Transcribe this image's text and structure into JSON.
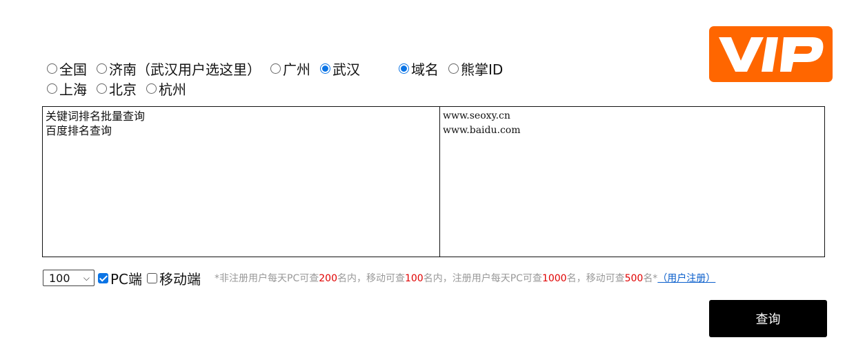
{
  "region_options": {
    "row1": [
      {
        "label": "全国",
        "checked": false
      },
      {
        "label": "济南（武汉用户选这里）",
        "checked": false
      },
      {
        "label": "广州",
        "checked": false
      },
      {
        "label": "武汉",
        "checked": true
      }
    ],
    "row2": [
      {
        "label": "上海",
        "checked": false
      },
      {
        "label": "北京",
        "checked": false
      },
      {
        "label": "杭州",
        "checked": false
      }
    ]
  },
  "mode_options": [
    {
      "label": "域名",
      "checked": true
    },
    {
      "label": "熊掌ID",
      "checked": false
    }
  ],
  "logo": {
    "text": "VIP",
    "bg_color": "#ff6600"
  },
  "keywords_textarea": {
    "lines": [
      "关键词排名批量查询",
      "百度排名查询"
    ]
  },
  "domains_textarea": {
    "lines": [
      "www.seoxy.cn",
      "www.baidu.com"
    ]
  },
  "options": {
    "count_select": {
      "value": "100"
    },
    "pc": {
      "label": "PC端",
      "checked": true
    },
    "mobile": {
      "label": "移动端",
      "checked": false
    }
  },
  "note": {
    "p1": "*非注册用户每天PC可查",
    "n1": "200",
    "p2": "名内，移动可查",
    "n2": "100",
    "p3": "名内，注册用户每天PC可查",
    "n3": "1000",
    "p4": "名，移动可查",
    "n4": "500",
    "p5": "名*",
    "link": "（用户注册）"
  },
  "query_button": {
    "label": "查询"
  }
}
